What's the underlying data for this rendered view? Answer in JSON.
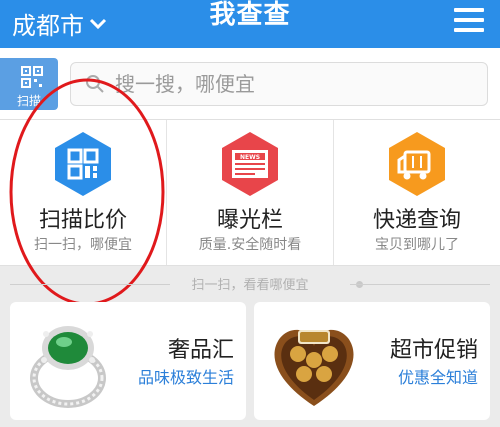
{
  "header": {
    "city": "成都市",
    "title": "我查查",
    "bg_color": "#2b8ee8"
  },
  "search": {
    "scan_label": "扫描",
    "placeholder": "搜一搜，哪便宜"
  },
  "features": [
    {
      "name": "扫描比价",
      "sub": "扫一扫，哪便宜",
      "icon": "barcode-icon",
      "color": "#2b8ee8"
    },
    {
      "name": "曝光栏",
      "sub": "质量.安全随时看",
      "icon": "news-icon",
      "color": "#e8454a"
    },
    {
      "name": "快递查询",
      "sub": "宝贝到哪儿了",
      "icon": "truck-icon",
      "color": "#f79a1e"
    }
  ],
  "divider_text": "扫一扫，看看哪便宜",
  "cards": [
    {
      "name": "奢品汇",
      "sub": "品味极致生活",
      "icon": "ring-image"
    },
    {
      "name": "超市促销",
      "sub": "优惠全知道",
      "icon": "chocolate-box-image"
    }
  ]
}
